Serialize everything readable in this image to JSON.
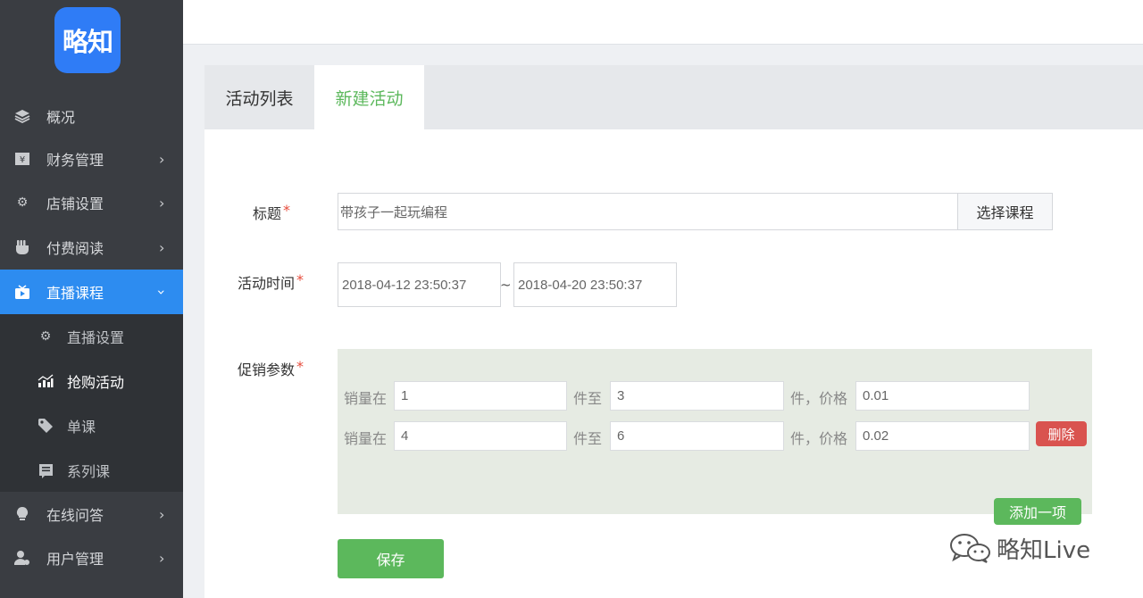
{
  "sidebar": {
    "logo_text": "略知",
    "items": [
      {
        "label": "概况",
        "icon": "layers-icon"
      },
      {
        "label": "财务管理",
        "icon": "finance-icon"
      },
      {
        "label": "店铺设置",
        "icon": "gear-icon"
      },
      {
        "label": "付费阅读",
        "icon": "pay-read-icon"
      },
      {
        "label": "直播课程",
        "icon": "live-tv-icon"
      },
      {
        "label": "在线问答",
        "icon": "lightbulb-icon"
      },
      {
        "label": "用户管理",
        "icon": "user-gear-icon"
      }
    ],
    "submenu": [
      {
        "label": "直播设置",
        "icon": "gear-icon"
      },
      {
        "label": "抢购活动",
        "icon": "bar-chart-icon"
      },
      {
        "label": "单课",
        "icon": "tag-icon"
      },
      {
        "label": "系列课",
        "icon": "book-icon"
      }
    ],
    "active_item": "直播课程",
    "current_submenu": "抢购活动",
    "active_color": "#2d8cf0"
  },
  "tabs": [
    {
      "label": "活动列表"
    },
    {
      "label": "新建活动"
    }
  ],
  "form": {
    "title_label": "标题",
    "title_value": "带孩子一起玩编程",
    "select_course_label": "选择课程",
    "time_label": "活动时间",
    "start_time": "2018-04-12 23:50:37",
    "time_separator": "~",
    "end_time": "2018-04-20 23:50:37",
    "promo_label": "促销参数",
    "required_mark": "*",
    "promo_rows": [
      {
        "sales_label": "销量在",
        "from": "1",
        "to_label": "件至",
        "to": "3",
        "price_label": "件，价格",
        "price": "0.01"
      },
      {
        "sales_label": "销量在",
        "from": "4",
        "to_label": "件至",
        "to": "6",
        "price_label": "件，价格",
        "price": "0.02"
      }
    ],
    "delete_label": "删除",
    "add_label": "添加一项",
    "save_label": "保存"
  },
  "watermark": {
    "text": "略知Live"
  },
  "colors": {
    "green": "#5cb85c",
    "red": "#d9534f",
    "blue": "#2d8cf0",
    "sidebar_bg": "#3a3d42"
  }
}
